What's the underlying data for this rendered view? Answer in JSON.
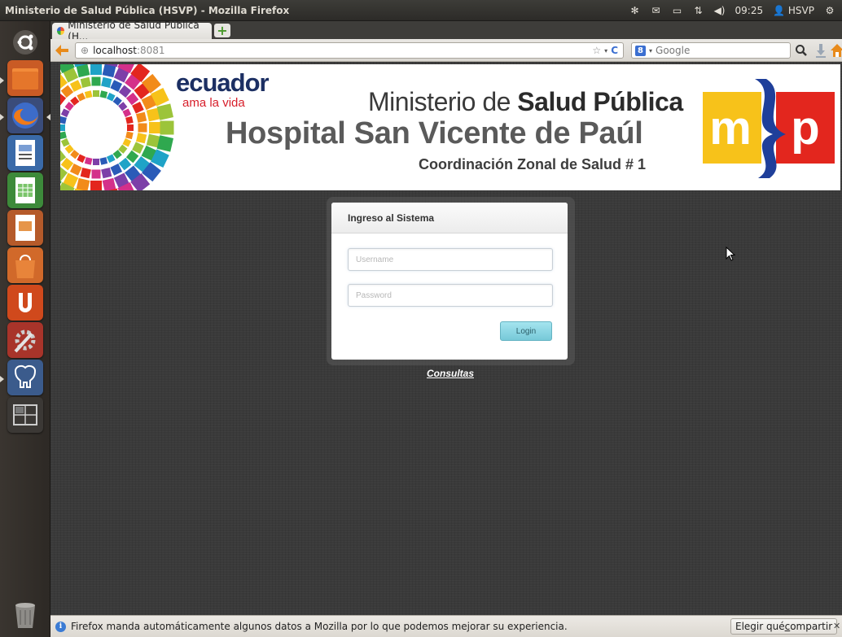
{
  "window": {
    "title": "Ministerio de Salud Pública (HSVP) - Mozilla Firefox"
  },
  "panel": {
    "time": "09:25",
    "user": "HSVP"
  },
  "launcher": {
    "items": [
      "dash-home",
      "files",
      "firefox",
      "writer",
      "calc",
      "impress",
      "software-center",
      "ubuntu-one",
      "system-settings",
      "pgadmin",
      "workspaces",
      "trash"
    ]
  },
  "browser": {
    "tab_title": "Ministerio de Salud Pública (H...",
    "url_host": "localhost",
    "url_port": ":8081",
    "search_placeholder": "Google",
    "search_engine_letter": "8"
  },
  "banner": {
    "brand": "ecuador",
    "slogan": "ama la vida",
    "ministry_prefix": "Ministerio de ",
    "ministry_bold": "Salud Pública",
    "hospital": "Hospital San Vicente de Paúl",
    "coordination": "Coordinación Zonal de Salud # 1",
    "logo_left": "m",
    "logo_right": "p"
  },
  "login": {
    "title": "Ingreso al Sistema",
    "username_placeholder": "Username",
    "password_placeholder": "Password",
    "button": "Login"
  },
  "links": {
    "consultas": "Consultas"
  },
  "notification": {
    "message": "Firefox manda automáticamente algunos datos a Mozilla por lo que podemos mejorar su experiencia.",
    "button_prefix": "Elegir qué ",
    "button_underlined": "c",
    "button_suffix": "ompartir"
  },
  "colors": {
    "accent_red": "#d71e2a",
    "brand_blue": "#1c2f63",
    "msp_yellow": "#f7c21a",
    "msp_red": "#e3261e",
    "msp_blue": "#1f3f9a",
    "login_button": "#77c9d8"
  }
}
